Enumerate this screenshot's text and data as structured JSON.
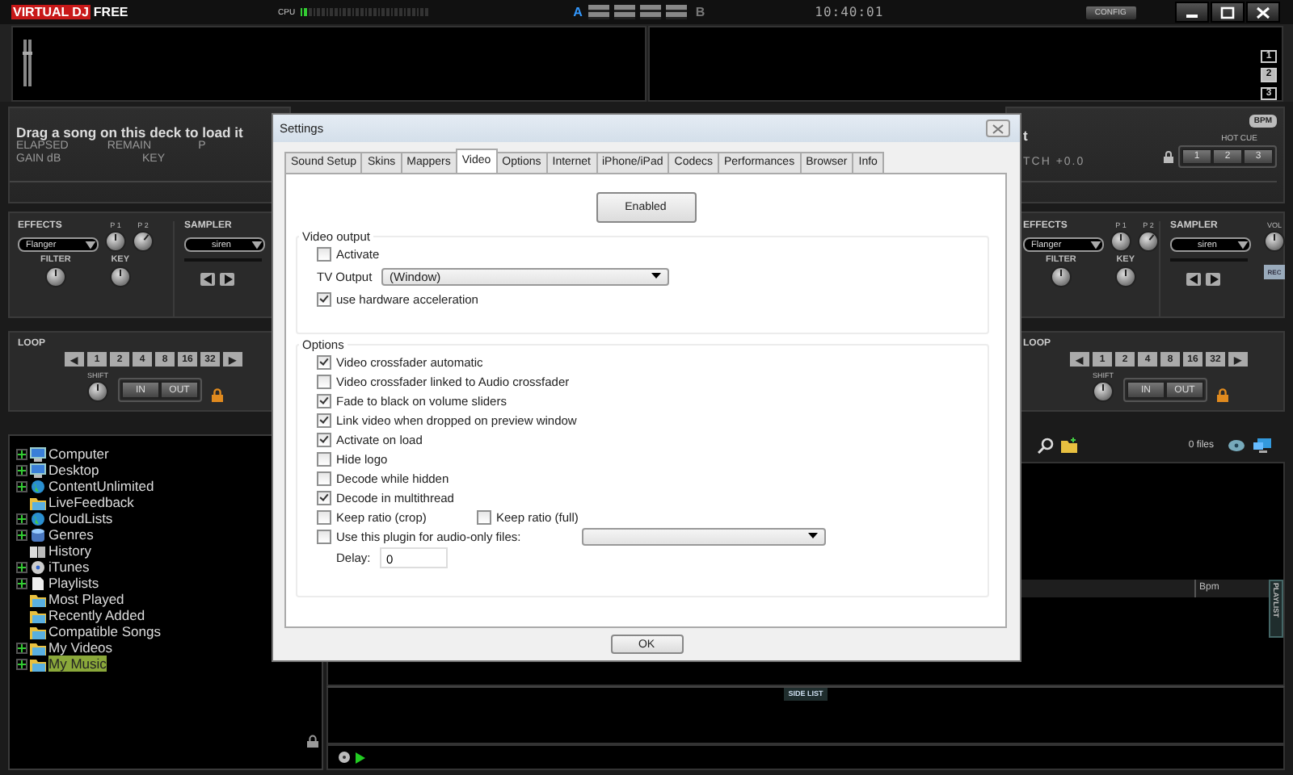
{
  "top_bar": {
    "logo": [
      {
        "text": "VIRTUAL",
        "kind": "brand"
      },
      {
        "text": "DJ",
        "kind": "brand"
      },
      {
        "text": "FREE",
        "kind": "edition"
      }
    ],
    "cpu_label": "CPU",
    "cpu": {
      "level": 0.07
    },
    "crossfader": {
      "left": "A",
      "right": "B"
    },
    "clock": "10:40:01",
    "config_button": "CONFIG"
  },
  "waveform": {
    "zoom_buttons": [
      {
        "label": "1",
        "selected": false
      },
      {
        "label": "2",
        "selected": true
      },
      {
        "label": "3",
        "selected": false
      }
    ]
  },
  "left_deck_info": {
    "message": "Drag a song on this deck to load it",
    "info_rows": [
      [
        "ELAPSED",
        "REMAIN",
        "P"
      ],
      [
        "GAIN dB",
        "KEY"
      ]
    ]
  },
  "right_deck_info": {
    "message_end": "t",
    "pitch": "TCH +0.0",
    "bpm_badge": "BPM",
    "hot_cue_label": "HOT CUE",
    "hot_cues": [
      "1",
      "2",
      "3"
    ]
  },
  "decks": [
    {
      "effects_label": "EFFECTS",
      "effect": "Flanger",
      "p1_label": "P 1",
      "p2_label": "P 2",
      "filter_label": "FILTER",
      "key_label": "KEY",
      "sampler_label": "SAMPLER",
      "sample": "siren",
      "loop_label": "LOOP",
      "loop_buttons": [
        "◀",
        "1",
        "2",
        "4",
        "8",
        "16",
        "32",
        "▶"
      ],
      "shift_label": "SHIFT",
      "in_button": "IN",
      "out_button": "OUT"
    },
    {
      "effects_label": "EFFECTS",
      "effect": "Flanger",
      "p1_label": "P 1",
      "p2_label": "P 2",
      "filter_label": "FILTER",
      "key_label": "KEY",
      "sampler_label": "SAMPLER",
      "sample": "siren",
      "vol_label": "VOL",
      "rec_button": "REC",
      "loop_label": "LOOP",
      "loop_buttons": [
        "◀",
        "1",
        "2",
        "4",
        "8",
        "16",
        "32",
        "▶"
      ],
      "shift_label": "SHIFT",
      "in_button": "IN",
      "out_button": "OUT"
    }
  ],
  "browser": {
    "tree": [
      {
        "label": "Computer",
        "kind": "monitor",
        "expandable": true,
        "selected": false
      },
      {
        "label": "Desktop",
        "kind": "monitor",
        "expandable": true,
        "selected": false
      },
      {
        "label": "ContentUnlimited",
        "kind": "globe",
        "expandable": true,
        "selected": false
      },
      {
        "label": "LiveFeedback",
        "kind": "folder",
        "expandable": false,
        "selected": false
      },
      {
        "label": "CloudLists",
        "kind": "globe",
        "expandable": true,
        "selected": false
      },
      {
        "label": "Genres",
        "kind": "database",
        "expandable": true,
        "selected": false
      },
      {
        "label": "History",
        "kind": "book",
        "expandable": false,
        "selected": false
      },
      {
        "label": "iTunes",
        "kind": "disc",
        "expandable": true,
        "selected": false
      },
      {
        "label": "Playlists",
        "kind": "page",
        "expandable": true,
        "selected": false
      },
      {
        "label": "Most Played",
        "kind": "folder",
        "expandable": false,
        "selected": false
      },
      {
        "label": "Recently Added",
        "kind": "folder",
        "expandable": false,
        "selected": false
      },
      {
        "label": "Compatible Songs",
        "kind": "folder",
        "expandable": false,
        "selected": false
      },
      {
        "label": "My Videos",
        "kind": "folder",
        "expandable": true,
        "selected": false
      },
      {
        "label": "My Music",
        "kind": "folder",
        "expandable": true,
        "selected": true
      }
    ],
    "files_count": "0 files",
    "columns": [
      "Bpm"
    ],
    "playlist_tab": "PLAYLIST",
    "side_list": "SIDE LIST"
  },
  "settings": {
    "title": "Settings",
    "tabs": [
      {
        "label": "Sound Setup",
        "selected": false
      },
      {
        "label": "Skins",
        "selected": false
      },
      {
        "label": "Mappers",
        "selected": false
      },
      {
        "label": "Video",
        "selected": true
      },
      {
        "label": "Options",
        "selected": false
      },
      {
        "label": "Internet",
        "selected": false
      },
      {
        "label": "iPhone/iPad",
        "selected": false
      },
      {
        "label": "Codecs",
        "selected": false
      },
      {
        "label": "Performances",
        "selected": false
      },
      {
        "label": "Browser",
        "selected": false
      },
      {
        "label": "Info",
        "selected": false
      }
    ],
    "enabled_button": "Enabled",
    "video_output": {
      "legend": "Video output",
      "activate": {
        "label": "Activate",
        "checked": false
      },
      "tv_output_label": "TV Output",
      "tv_output_value": "(Window)",
      "hardware": {
        "label": "use hardware acceleration",
        "checked": true
      }
    },
    "options": {
      "legend": "Options",
      "checkboxes": [
        {
          "label": "Video crossfader automatic",
          "checked": true
        },
        {
          "label": "Video crossfader linked to Audio crossfader",
          "checked": false
        },
        {
          "label": "Fade to black on volume sliders",
          "checked": true
        },
        {
          "label": "Link video when dropped on preview window",
          "checked": true
        },
        {
          "label": "Activate on load",
          "checked": true
        },
        {
          "label": "Hide logo",
          "checked": false
        },
        {
          "label": "Decode while hidden",
          "checked": false
        },
        {
          "label": "Decode in multithread",
          "checked": true
        }
      ],
      "keep_ratio": [
        {
          "label": "Keep ratio (crop)",
          "checked": false
        },
        {
          "label": "Keep ratio (full)",
          "checked": false
        }
      ],
      "plugin": {
        "label": "Use this plugin for audio-only files:",
        "checked": false
      },
      "delay_label": "Delay:",
      "delay_value": "0"
    },
    "ok_button": "OK"
  }
}
